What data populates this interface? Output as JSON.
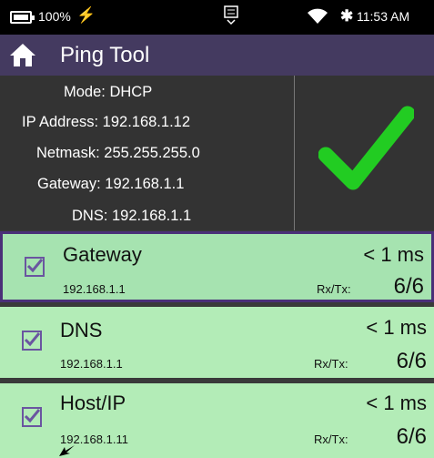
{
  "status_bar": {
    "battery": "100%",
    "time": "11:53 AM"
  },
  "header": {
    "title": "Ping Tool"
  },
  "info": {
    "mode": "Mode: DHCP",
    "ip": "IP Address: 192.168.1.12",
    "netmask": "Netmask: 255.255.255.0",
    "gateway": "Gateway: 192.168.1.1",
    "dns": "DNS: 192.168.1.1"
  },
  "targets": [
    {
      "name": "Gateway",
      "address": "192.168.1.1",
      "latency": "< 1 ms",
      "rx_label": "Rx/Tx:",
      "ratio": "6/6"
    },
    {
      "name": "DNS",
      "address": "192.168.1.1",
      "latency": "< 1 ms",
      "rx_label": "Rx/Tx:",
      "ratio": "6/6"
    },
    {
      "name": "Host/IP",
      "address": "192.168.1.11",
      "latency": "< 1 ms",
      "rx_label": "Rx/Tx:",
      "ratio": "6/6"
    }
  ],
  "colors": {
    "accent": "#443a60",
    "card": "#b3ecb7",
    "check": "#22cc22"
  }
}
